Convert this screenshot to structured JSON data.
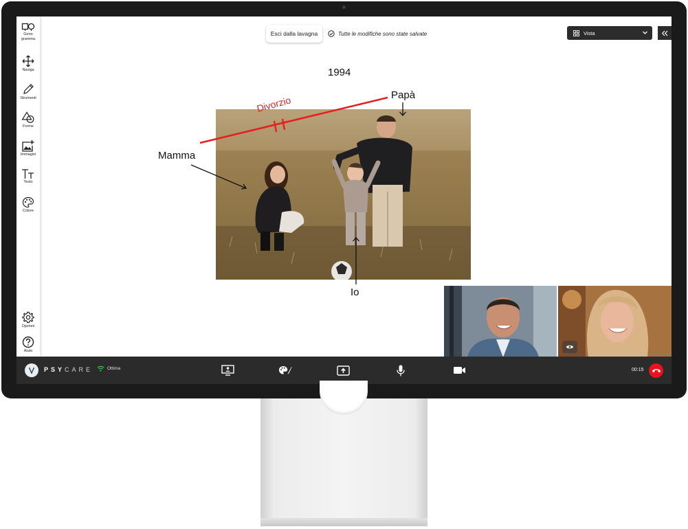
{
  "toolbar": {
    "items": [
      {
        "label": "Geno gramma",
        "icon": "genogram-icon"
      },
      {
        "label": "Naviga",
        "icon": "move-icon"
      },
      {
        "label": "Strumenti",
        "icon": "pencil-icon"
      },
      {
        "label": "Forme",
        "icon": "shapes-icon"
      },
      {
        "label": "Immagini",
        "icon": "add-image-icon"
      },
      {
        "label": "Testo",
        "icon": "text-icon"
      },
      {
        "label": "Colore",
        "icon": "palette-icon"
      },
      {
        "label": "Opzioni",
        "icon": "gear-icon"
      },
      {
        "label": "Aiuto",
        "icon": "help-icon"
      }
    ]
  },
  "header": {
    "exit_label": "Esci dalla lavagna",
    "saved_text": "Tutte le modifiche sono state salvate",
    "view_label": "Vista"
  },
  "canvas": {
    "year": "1994",
    "labels": {
      "dad": "Papà",
      "mom": "Mamma",
      "me": "Io",
      "divorce": "Divorzio"
    },
    "colors": {
      "divorce_line": "#e62020"
    }
  },
  "bottom": {
    "brand_bold": "PSY",
    "brand_light": "CARE",
    "connection": "Ottima",
    "timer": "00:15",
    "icons": [
      "share-screen-icon",
      "whiteboard-palette-icon",
      "upload-icon",
      "microphone-icon",
      "camera-icon",
      "hangup-icon"
    ],
    "colors": {
      "hangup": "#e8141b",
      "signal": "#3ec43e"
    }
  }
}
